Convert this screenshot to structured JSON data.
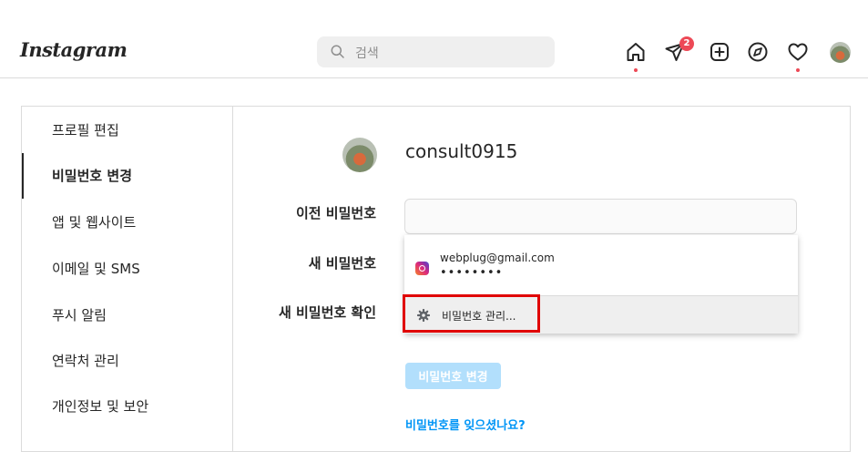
{
  "header": {
    "logo_text": "Instagram",
    "search": {
      "placeholder": "검색",
      "icon": "search-icon"
    },
    "nav_icons": [
      "home-icon",
      "direct-message-icon",
      "new-post-icon",
      "explore-icon",
      "activity-heart-icon",
      "profile-avatar"
    ],
    "message_badge": "2",
    "notification_dot_color": "#ed4956"
  },
  "sidebar": {
    "items": [
      {
        "label": "프로필 편집",
        "active": false
      },
      {
        "label": "비밀번호 변경",
        "active": true
      },
      {
        "label": "앱 및 웹사이트",
        "active": false
      },
      {
        "label": "이메일 및 SMS",
        "active": false
      },
      {
        "label": "푸시 알림",
        "active": false
      },
      {
        "label": "연락처 관리",
        "active": false
      },
      {
        "label": "개인정보 및 보안",
        "active": false
      }
    ]
  },
  "main": {
    "username": "consult0915",
    "fields": {
      "old_password_label": "이전 비밀번호",
      "new_password_label": "새 비밀번호",
      "confirm_password_label": "새 비밀번호 확인"
    },
    "autofill": {
      "icon": "instagram-icon",
      "email": "webplug@gmail.com",
      "masked_password": "••••••••",
      "manage_icon": "gear-icon",
      "manage_label": "비밀번호 관리..."
    },
    "submit_label": "비밀번호 변경",
    "forgot_label": "비밀번호를 잊으셨나요?"
  },
  "colors": {
    "accent_link": "#0095f6",
    "disabled_button": "#b2dffc",
    "highlight_border": "#e00000"
  }
}
